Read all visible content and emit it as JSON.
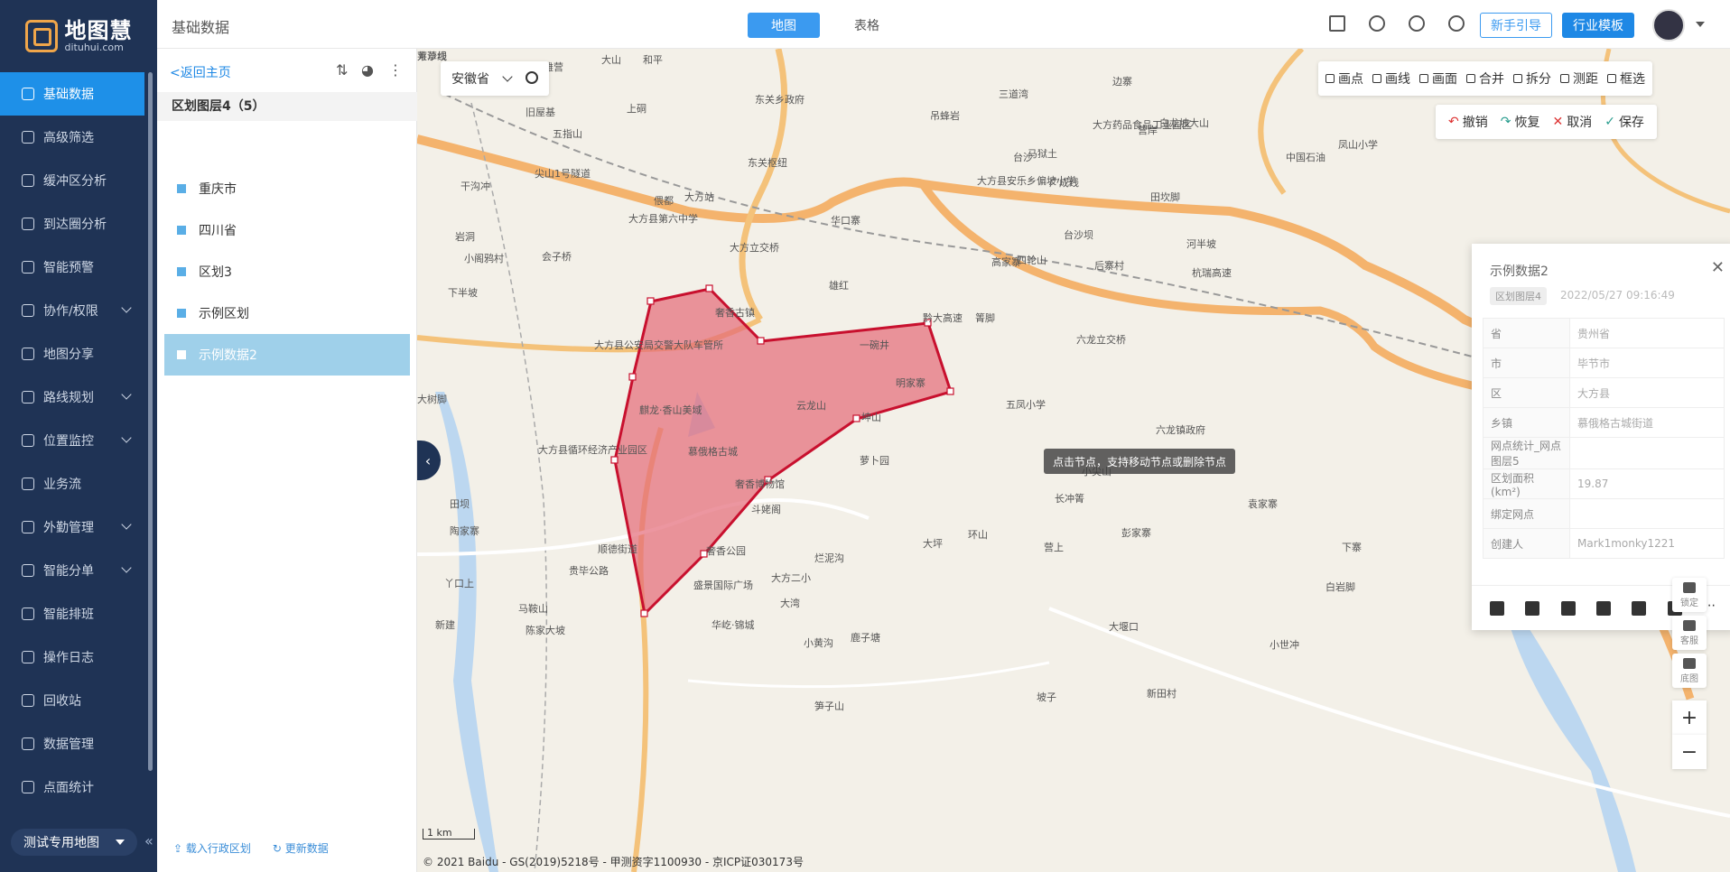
{
  "sidebar": {
    "logo_cn": "地图慧",
    "logo_en": "dituhui.com",
    "items": [
      {
        "label": "基础数据"
      },
      {
        "label": "高级筛选"
      },
      {
        "label": "缓冲区分析"
      },
      {
        "label": "到达圈分析"
      },
      {
        "label": "智能预警"
      },
      {
        "label": "协作/权限"
      },
      {
        "label": "地图分享"
      },
      {
        "label": "路线规划"
      },
      {
        "label": "位置监控"
      },
      {
        "label": "业务流"
      },
      {
        "label": "外勤管理"
      },
      {
        "label": "智能分单"
      },
      {
        "label": "智能排班"
      },
      {
        "label": "操作日志"
      },
      {
        "label": "回收站"
      },
      {
        "label": "数据管理"
      },
      {
        "label": "点面统计"
      }
    ],
    "map_select": "测试专用地图"
  },
  "topbar": {
    "title": "基础数据",
    "tab_map": "地图",
    "tab_table": "表格",
    "guide": "新手引导",
    "template": "行业模板"
  },
  "layer_panel": {
    "back": "<返回主页",
    "header": "区划图层4（5）",
    "items": [
      {
        "label": "重庆市"
      },
      {
        "label": "四川省"
      },
      {
        "label": "区划3"
      },
      {
        "label": "示例区划"
      },
      {
        "label": "示例数据2"
      }
    ],
    "load_admin": "载入行政区划",
    "update_data": "更新数据"
  },
  "map": {
    "province": "安徽省",
    "draw_tools": [
      "画点",
      "画线",
      "画面",
      "合并",
      "拆分",
      "测距",
      "框选"
    ],
    "edit_tools": [
      "撤销",
      "恢复",
      "取消",
      "保存"
    ],
    "tooltip": "点击节点，支持移动节点或删除节点",
    "scale": "1 km",
    "copyright": "© 2021 Baidu - GS(2019)5218号 - 甲测资字1100930 - 京ICP证030173号",
    "labels": [
      "大方立交桥",
      "奢香古镇",
      "大方县公安局交警大队车管所",
      "云龙山",
      "慕俄格古城",
      "奢香博物馆",
      "斗姥阁",
      "奢香公园",
      "大方二小",
      "盛景国际广场",
      "华屹·锦城",
      "黔大高速",
      "一碗井",
      "明家寨",
      "五凤小学",
      "六龙立交桥",
      "东关枢纽",
      "东关乡政府",
      "大方站",
      "大方县第六中学",
      "华口寨",
      "雄红",
      "四轮山",
      "后寨村",
      "台沙坝",
      "高家寨",
      "大方县循环经济产业园区",
      "麒龙·香山美域",
      "马鞍山",
      "陈家大坡",
      "新建",
      "顺德街道",
      "贵毕公路",
      "大方药品食品工业园区",
      "吊蜂岩",
      "大方县安乐乡偏坡小学",
      "三道湾",
      "马狱土",
      "边寨",
      "白龙坡大山",
      "凤山小学",
      "中国石油",
      "杭瑞高速",
      "小尖山",
      "长冲箐",
      "六龙镇政府",
      "环山",
      "大坪",
      "营上",
      "烂泥沟",
      "大湾",
      "小黄沟",
      "鹿子塘",
      "大堰口",
      "小世冲",
      "新田村",
      "坡子",
      "笋子山",
      "白岩脚",
      "袁家寨",
      "彭家寨",
      "下寨",
      "尖山1号隧道",
      "五指山",
      "旧屋基",
      "上硐",
      "和平",
      "大山",
      "莱草坝",
      "雄营",
      "干沟冲",
      "岩洞",
      "小阁鸦村",
      "会子桥",
      "下半坡",
      "大树脚",
      "田坝",
      "陶家寨",
      "丫口上",
      "萝卜园",
      "坤山",
      "箐脚",
      "田坎脚",
      "河半坡",
      "台沙",
      "营岸",
      "偎都",
      "广成线",
      "方沙线"
    ]
  },
  "info_card": {
    "title": "示例数据2",
    "layer": "区划图层4",
    "date": "2022/05/27 09:16:49",
    "rows": [
      {
        "k": "省",
        "v": "贵州省"
      },
      {
        "k": "市",
        "v": "毕节市"
      },
      {
        "k": "区",
        "v": "大方县"
      },
      {
        "k": "乡镇",
        "v": "慕俄格古城街道"
      },
      {
        "k": "网点统计_网点图层5",
        "v": ""
      },
      {
        "k": "区划面积(km²)",
        "v": "19.87"
      },
      {
        "k": "绑定网点",
        "v": ""
      },
      {
        "k": "创建人",
        "v": "Mark1monky1221"
      }
    ]
  },
  "rail": {
    "lock": "锁定",
    "service": "客服",
    "basemap": "底图",
    "zoom_in": "+",
    "zoom_out": "−"
  },
  "colors": {
    "sidebar_bg": "#1f3355",
    "accent": "#1e90e8",
    "polygon_fill": "#e46a78",
    "polygon_stroke": "#c8102e"
  }
}
